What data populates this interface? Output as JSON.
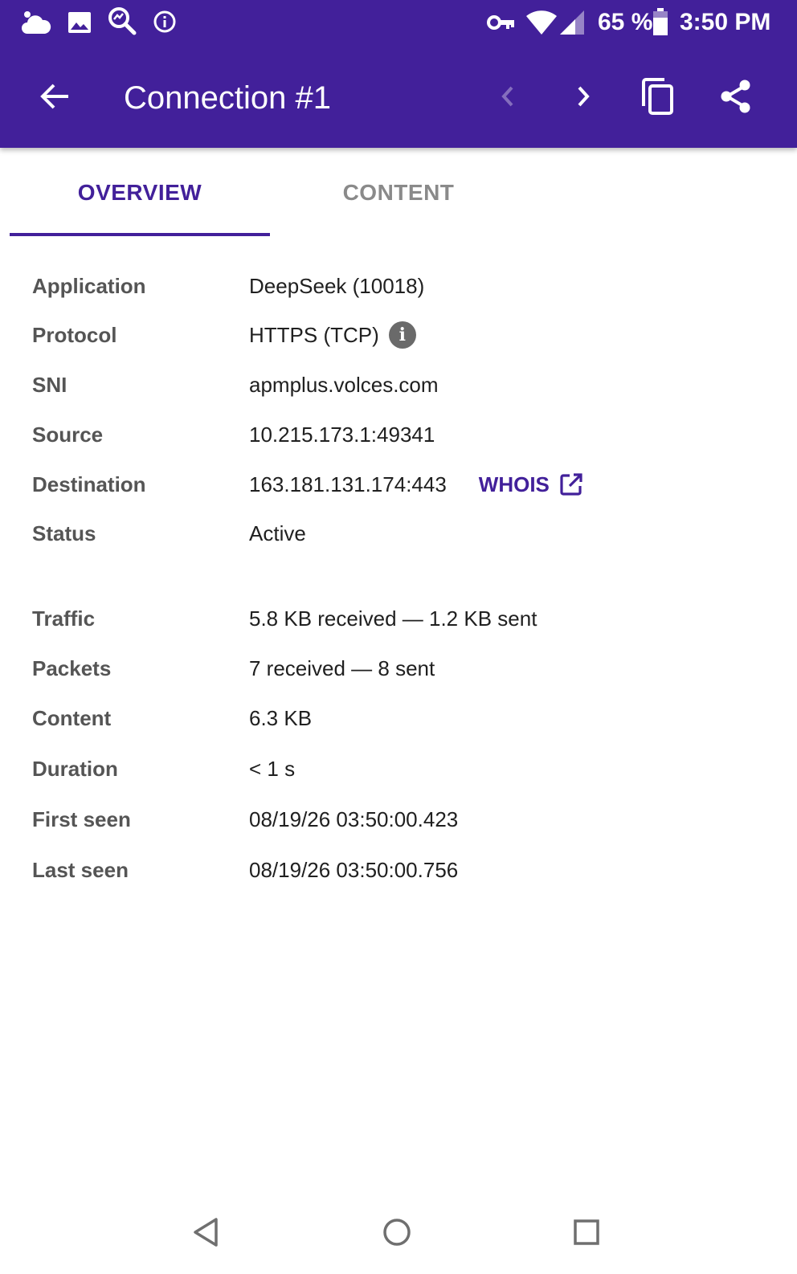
{
  "status_bar": {
    "icons": [
      "weather-cloud-icon",
      "image-icon",
      "search-icon",
      "info-icon",
      "vpn-key-icon",
      "wifi-icon",
      "signal-icon",
      "battery-icon"
    ],
    "battery": "65 %",
    "time": "3:50 PM"
  },
  "toolbar": {
    "title": "Connection #1",
    "icons": [
      "back-arrow-icon",
      "chevron-left-icon",
      "chevron-right-icon",
      "copy-icon",
      "share-icon"
    ]
  },
  "tabs": [
    {
      "label": "OVERVIEW",
      "active": true
    },
    {
      "label": "CONTENT",
      "active": false
    }
  ],
  "details": {
    "application": {
      "label": "Application",
      "value": "DeepSeek (10018)"
    },
    "protocol": {
      "label": "Protocol",
      "value": "HTTPS (TCP)"
    },
    "sni": {
      "label": "SNI",
      "value": "apmplus.volces.com"
    },
    "source": {
      "label": "Source",
      "value": "10.215.173.1:49341"
    },
    "destination": {
      "label": "Destination",
      "value": "163.181.131.174:443",
      "action": "WHOIS"
    },
    "status": {
      "label": "Status",
      "value": "Active"
    },
    "traffic": {
      "label": "Traffic",
      "value": "5.8 KB received — 1.2 KB sent"
    },
    "packets": {
      "label": "Packets",
      "value": "7 received — 8 sent"
    },
    "content": {
      "label": "Content",
      "value": "6.3 KB"
    },
    "duration": {
      "label": "Duration",
      "value": "< 1 s"
    },
    "first_seen": {
      "label": "First seen",
      "value": "08/19/26 03:50:00.423"
    },
    "last_seen": {
      "label": "Last seen",
      "value": "08/19/26 03:50:00.756"
    }
  },
  "colors": {
    "primary": "#42209a",
    "label": "#555555",
    "value": "#202020",
    "inactive_tab": "#8a8a8a"
  },
  "nav_bar": {
    "icons": [
      "nav-back-icon",
      "nav-home-icon",
      "nav-recents-icon"
    ]
  }
}
